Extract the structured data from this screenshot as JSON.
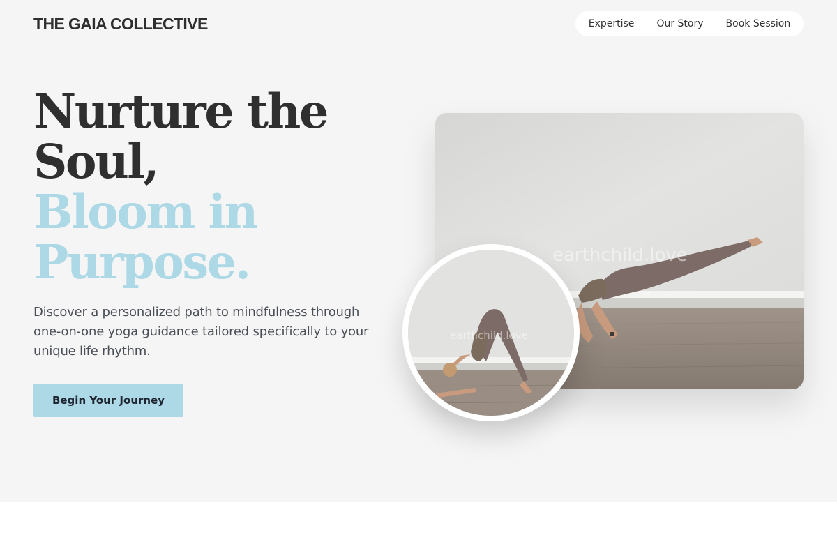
{
  "brand": {
    "name": "THE GAIA COLLECTIVE"
  },
  "nav": {
    "items": [
      {
        "label": "Expertise"
      },
      {
        "label": "Our Story"
      },
      {
        "label": "Book Session"
      }
    ]
  },
  "hero": {
    "headline_dark": [
      "Nurture the",
      "Soul,"
    ],
    "headline_accent": [
      "Bloom in",
      "Purpose."
    ],
    "description": "Discover a personalized path to mindfulness through one-on-one yoga guidance tailored specifically to your unique life rhythm.",
    "cta_label": "Begin Your Journey"
  },
  "images": {
    "main_watermark": "earthchild.love",
    "inset_watermark": "earthchild.love"
  },
  "colors": {
    "accent": "#add8e6",
    "text_dark": "#2f2f2f",
    "hero_bg": "#f5f5f5"
  }
}
